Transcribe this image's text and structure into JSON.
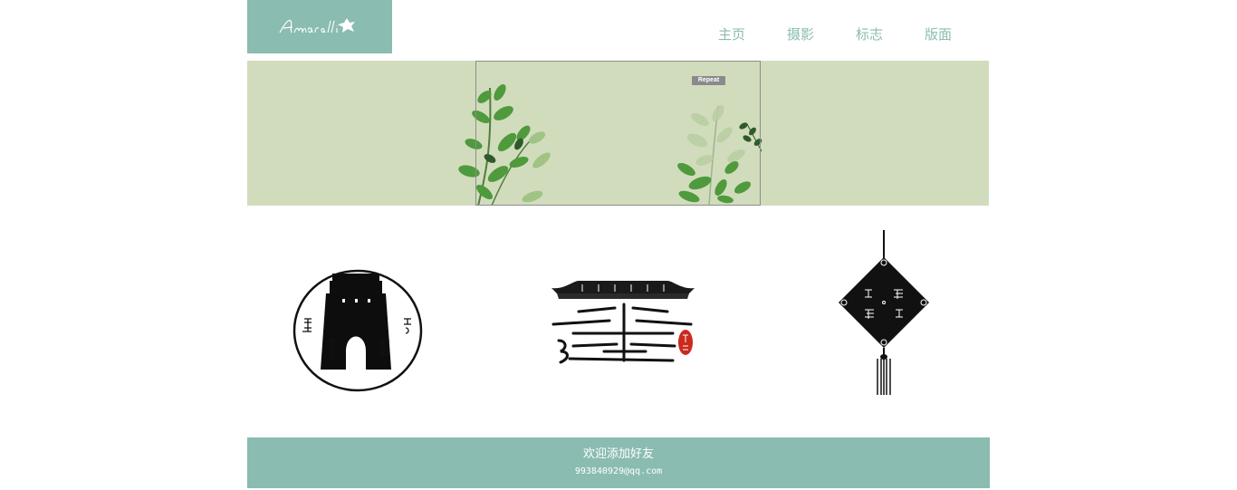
{
  "brand": {
    "logo_text": "Amarilli",
    "logo_icon": "leaf-icon",
    "accent_color": "#8abcb1"
  },
  "nav": {
    "items": [
      {
        "label": "主页"
      },
      {
        "label": "摄影"
      },
      {
        "label": "标志"
      },
      {
        "label": "版面"
      }
    ]
  },
  "banner": {
    "background_color": "#d1dcbd",
    "badge": "Repeat"
  },
  "logos": [
    {
      "name": "gate-emblem"
    },
    {
      "name": "roof-character-emblem"
    },
    {
      "name": "diamond-tassel-emblem"
    }
  ],
  "footer": {
    "title": "欢迎添加好友",
    "email": "993840929@qq.com"
  }
}
